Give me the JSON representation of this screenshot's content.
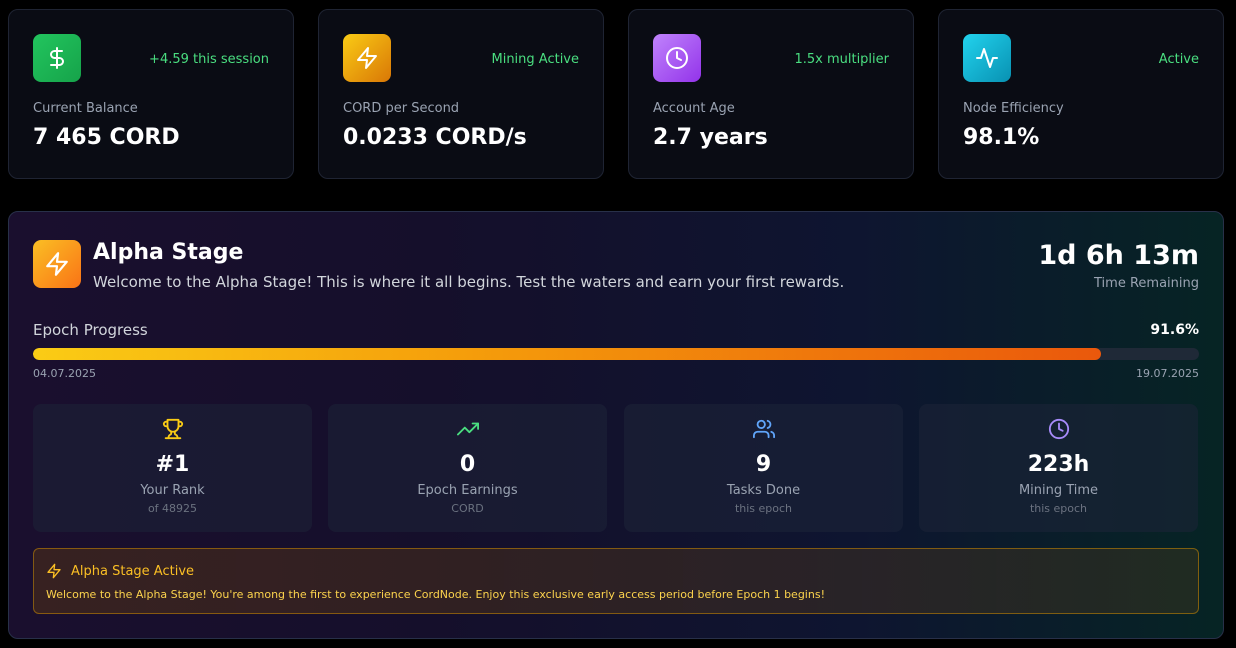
{
  "stats": [
    {
      "icon": "dollar-icon",
      "badge": "+4.59 this session",
      "label": "Current Balance",
      "value": "7 465 CORD",
      "gradient_from": "#22c55e",
      "gradient_to": "#16a34a"
    },
    {
      "icon": "lightning-icon",
      "badge": "Mining Active",
      "label": "CORD per Second",
      "value": "0.0233 CORD/s",
      "gradient_from": "#facc15",
      "gradient_to": "#d97706"
    },
    {
      "icon": "clock-icon",
      "badge": "1.5x multiplier",
      "label": "Account Age",
      "value": "2.7 years",
      "gradient_from": "#c084fc",
      "gradient_to": "#9333ea"
    },
    {
      "icon": "activity-icon",
      "badge": "Active",
      "label": "Node Efficiency",
      "value": "98.1%",
      "gradient_from": "#22d3ee",
      "gradient_to": "#0891b2"
    }
  ],
  "epoch": {
    "title": "Alpha Stage",
    "description": "Welcome to the Alpha Stage! This is where it all begins. Test the waters and earn your first rewards.",
    "time_remaining": "1d 6h 13m",
    "time_label": "Time Remaining",
    "progress_label": "Epoch Progress",
    "progress_percent_text": "91.6%",
    "progress_value": 91.6,
    "start_date": "04.07.2025",
    "end_date": "19.07.2025"
  },
  "metrics": [
    {
      "icon": "trophy-icon",
      "value": "#1",
      "label": "Your Rank",
      "sub": "of 48925",
      "color": "#facc15"
    },
    {
      "icon": "trending-up-icon",
      "value": "0",
      "label": "Epoch Earnings",
      "sub": "CORD",
      "color": "#4ade80"
    },
    {
      "icon": "users-icon",
      "value": "9",
      "label": "Tasks Done",
      "sub": "this epoch",
      "color": "#60a5fa"
    },
    {
      "icon": "clock-icon",
      "value": "223h",
      "label": "Mining Time",
      "sub": "this epoch",
      "color": "#a78bfa"
    }
  ],
  "notice": {
    "title": "Alpha Stage Active",
    "text": "Welcome to the Alpha Stage! You're among the first to experience CordNode. Enjoy this exclusive early access period before Epoch 1 begins!"
  },
  "colors": {
    "accent_green": "#4ade80",
    "accent_yellow": "#fbbf24",
    "panel_bg": "#0a0c14"
  }
}
